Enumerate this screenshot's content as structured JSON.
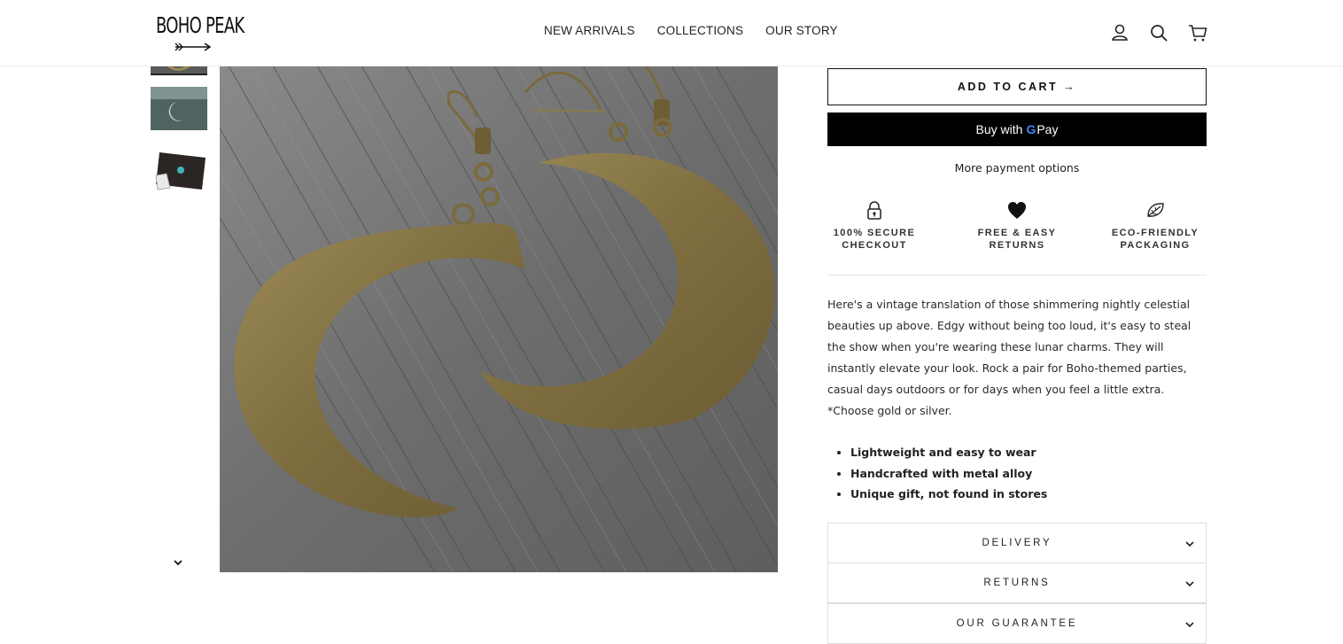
{
  "header": {
    "logo_text": "BOHO PEAK",
    "nav": [
      "NEW ARRIVALS",
      "COLLECTIONS",
      "OUR STORY"
    ],
    "icons": [
      "account-icon",
      "search-icon",
      "cart-icon"
    ]
  },
  "gallery": {
    "thumbnails": [
      "moon-earrings-thumb-bronze",
      "moon-earrings-thumb-silver",
      "earring-gift-box-thumb"
    ],
    "scroll_icon": "chevron-down-icon"
  },
  "buy": {
    "add_to_cart": "ADD TO CART →",
    "gpay_prefix": "Buy with",
    "gpay_g": "G",
    "gpay_suffix": "Pay",
    "more_payment": "More payment options"
  },
  "features": [
    {
      "icon": "lock-icon",
      "label": "100% SECURE\nCHECKOUT"
    },
    {
      "icon": "heart-icon",
      "label": "FREE & EASY\nRETURNS"
    },
    {
      "icon": "leaf-icon",
      "label": "ECO-FRIENDLY\nPACKAGING"
    }
  ],
  "product": {
    "description": "Here's a vintage translation of those shimmering nightly celestial beauties up above. Edgy without being too loud, it's easy to steal the show when you're wearing these lunar charms. They will instantly elevate your look.  Rock a pair for Boho-themed parties, casual days outdoors or for days when you feel a little extra. *Choose gold or silver.",
    "bullets": [
      "Lightweight and easy to wear",
      "Handcrafted with metal alloy",
      "Unique gift, not found in stores"
    ]
  },
  "accordions": [
    "DELIVERY",
    "RETURNS",
    "OUR GUARANTEE"
  ],
  "colors": {
    "accent": "#000000",
    "bronze": "#8a7a4a",
    "wood": "#6e6e6e"
  }
}
